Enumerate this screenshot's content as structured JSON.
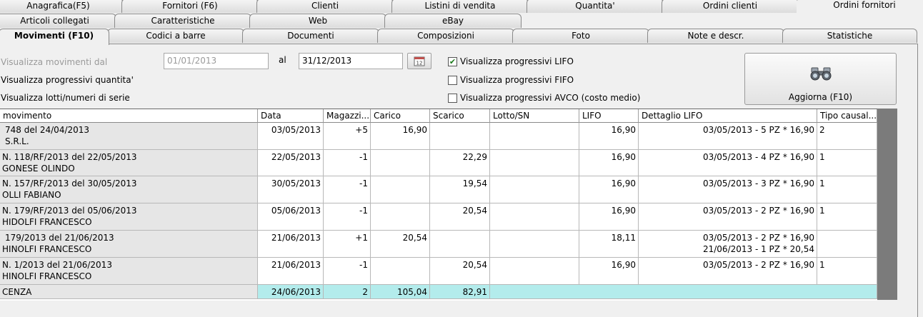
{
  "tabs_row1": [
    "Anagrafica(F5)",
    "Fornitori (F6)",
    "Clienti",
    "Listini di vendita",
    "Quantita'",
    "Ordini clienti",
    "Ordini fornitori"
  ],
  "tabs_row2": [
    "Articoli collegati",
    "Caratteristiche",
    "Web",
    "eBay"
  ],
  "tabs_row3": [
    "Movimenti (F10)",
    "Codici a barre",
    "Documenti",
    "Composizioni",
    "Foto",
    "Note e descr.",
    "Statistiche"
  ],
  "filters": {
    "from_label": "Visualizza movimenti dal",
    "from_value": "01/01/2013",
    "to_label": "al",
    "to_value": "31/12/2013",
    "qty_progressive_label": "Visualizza progressivi quantita'",
    "lots_label": "Visualizza lotti/numeri di serie",
    "lifo_label": "Visualizza progressivi LIFO",
    "lifo_checked": true,
    "fifo_label": "Visualizza progressivi FIFO",
    "fifo_checked": false,
    "avco_label": "Visualizza progressivi AVCO (costo medio)",
    "avco_checked": false,
    "refresh_label": "Aggiorna (F10)"
  },
  "icons": {
    "calendar": "calendar-icon",
    "binoculars": "binoculars-icon",
    "check": "check-icon"
  },
  "colors": {
    "total_row": "#b3ecec",
    "first_col": "#e6e6e6",
    "scroll_area": "#7b7b7b"
  },
  "table": {
    "headers": [
      "movimento",
      "Data",
      "Magazzi...",
      "Carico",
      "Scarico",
      "Lotto/SN",
      "LIFO",
      "Dettaglio LIFO",
      "Tipo causal..."
    ],
    "rows": [
      {
        "mov1": "748 del 24/04/2013",
        "mov2": "S.R.L.",
        "data": "03/05/2013",
        "mag": "+5",
        "carico": "16,90",
        "scarico": "",
        "lotto": "",
        "lifo": "16,90",
        "det1": "03/05/2013 - 5 PZ * 16,90",
        "det2": "",
        "tipo": "2"
      },
      {
        "mov1": "N. 118/RF/2013 del 22/05/2013",
        "mov2": "GONESE OLINDO",
        "data": "22/05/2013",
        "mag": "-1",
        "carico": "",
        "scarico": "22,29",
        "lotto": "",
        "lifo": "16,90",
        "det1": "03/05/2013 - 4 PZ * 16,90",
        "det2": "",
        "tipo": "1"
      },
      {
        "mov1": "N. 157/RF/2013 del 30/05/2013",
        "mov2": "OLLI FABIANO",
        "data": "30/05/2013",
        "mag": "-1",
        "carico": "",
        "scarico": "19,54",
        "lotto": "",
        "lifo": "16,90",
        "det1": "03/05/2013 - 3 PZ * 16,90",
        "det2": "",
        "tipo": "1"
      },
      {
        "mov1": "N. 179/RF/2013 del 05/06/2013",
        "mov2": "HIDOLFI FRANCESCO",
        "data": "05/06/2013",
        "mag": "-1",
        "carico": "",
        "scarico": "20,54",
        "lotto": "",
        "lifo": "16,90",
        "det1": "03/05/2013 - 2 PZ * 16,90",
        "det2": "",
        "tipo": "1"
      },
      {
        "mov1": "179/2013 del 21/06/2013",
        "mov2": "HINOLFI FRANCESCO",
        "data": "21/06/2013",
        "mag": "+1",
        "carico": "20,54",
        "scarico": "",
        "lotto": "",
        "lifo": "18,11",
        "det1": "03/05/2013 - 2 PZ * 16,90",
        "det2": "21/06/2013 - 1 PZ * 20,54",
        "tipo": ""
      },
      {
        "mov1": "N. 1/2013 del 21/06/2013",
        "mov2": "HINOLFI FRANCESCO",
        "data": "21/06/2013",
        "mag": "-1",
        "carico": "",
        "scarico": "20,54",
        "lotto": "",
        "lifo": "16,90",
        "det1": "03/05/2013 - 2 PZ * 16,90",
        "det2": "",
        "tipo": "1"
      }
    ],
    "total": {
      "label": "CENZA",
      "data": "24/06/2013",
      "mag": "2",
      "carico": "105,04",
      "scarico": "82,91"
    }
  }
}
